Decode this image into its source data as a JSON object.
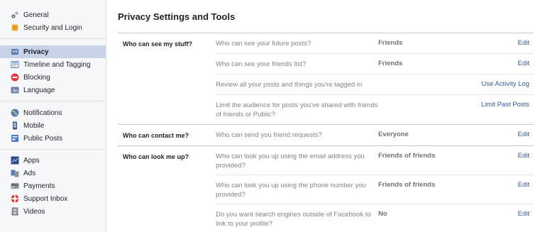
{
  "sidebar": {
    "groups": [
      [
        {
          "label": "General",
          "icon": "gear-icon"
        },
        {
          "label": "Security and Login",
          "icon": "shield-icon"
        }
      ],
      [
        {
          "label": "Privacy",
          "icon": "lock-icon",
          "active": true
        },
        {
          "label": "Timeline and Tagging",
          "icon": "timeline-icon"
        },
        {
          "label": "Blocking",
          "icon": "block-icon"
        },
        {
          "label": "Language",
          "icon": "language-icon"
        }
      ],
      [
        {
          "label": "Notifications",
          "icon": "globe-icon"
        },
        {
          "label": "Mobile",
          "icon": "mobile-icon"
        },
        {
          "label": "Public Posts",
          "icon": "feed-icon"
        }
      ],
      [
        {
          "label": "Apps",
          "icon": "apps-icon"
        },
        {
          "label": "Ads",
          "icon": "ads-icon"
        },
        {
          "label": "Payments",
          "icon": "card-icon"
        },
        {
          "label": "Support Inbox",
          "icon": "lifebuoy-icon"
        },
        {
          "label": "Videos",
          "icon": "film-icon"
        }
      ]
    ]
  },
  "main": {
    "title": "Privacy Settings and Tools",
    "sections": [
      {
        "label": "Who can see my stuff?",
        "rows": [
          {
            "question": "Who can see your future posts?",
            "answer": "Friends",
            "action": "Edit"
          },
          {
            "question": "Who can see your friends list?",
            "answer": "Friends",
            "action": "Edit"
          },
          {
            "question": "Review all your posts and things you're tagged in",
            "answer": "",
            "action": "Use Activity Log"
          },
          {
            "question": "Limit the audience for posts you've shared with friends of friends or Public?",
            "answer": "",
            "action": "Limit Past Posts"
          }
        ]
      },
      {
        "label": "Who can contact me?",
        "rows": [
          {
            "question": "Who can send you friend requests?",
            "answer": "Everyone",
            "action": "Edit"
          }
        ]
      },
      {
        "label": "Who can look me up?",
        "rows": [
          {
            "question": "Who can look you up using the email address you provided?",
            "answer": "Friends of friends",
            "action": "Edit"
          },
          {
            "question": "Who can look you up using the phone number you provided?",
            "answer": "Friends of friends",
            "action": "Edit"
          },
          {
            "question": "Do you want search engines outside of Facebook to link to your profile?",
            "answer": "No",
            "action": "Edit"
          }
        ]
      }
    ]
  }
}
